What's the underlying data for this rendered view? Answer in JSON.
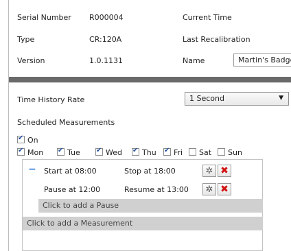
{
  "device": {
    "serial_label": "Serial Number",
    "serial_value": "R000004",
    "type_label": "Type",
    "type_value": "CR:120A",
    "version_label": "Version",
    "version_value": "1.0.1131",
    "current_time_label": "Current Time",
    "last_recal_label": "Last Recalibration",
    "name_label": "Name",
    "name_value": "Martin's Badge"
  },
  "time_history": {
    "label": "Time History Rate",
    "selected": "1 Second"
  },
  "scheduled": {
    "label": "Scheduled Measurements",
    "on_label": "On",
    "on_checked": true,
    "days": [
      {
        "label": "Mon",
        "checked": true
      },
      {
        "label": "Tue",
        "checked": true
      },
      {
        "label": "Wed",
        "checked": true
      },
      {
        "label": "Thu",
        "checked": true
      },
      {
        "label": "Fri",
        "checked": true
      },
      {
        "label": "Sat",
        "checked": false
      },
      {
        "label": "Sun",
        "checked": false
      }
    ],
    "measurement": {
      "collapse_symbol": "−",
      "start": "Start at 08:00",
      "stop": "Stop at 18:00",
      "pause": "Pause at 12:00",
      "resume": "Resume at 13:00",
      "add_pause": "Click to add a Pause"
    },
    "add_measurement": "Click to add a Measurement"
  },
  "icons": {
    "settings": "gear-icon",
    "delete": "close-icon"
  },
  "colors": {
    "delete_red": "#d21414",
    "collapse_blue": "#2b78d6",
    "add_bar": "#d0d0d0"
  }
}
